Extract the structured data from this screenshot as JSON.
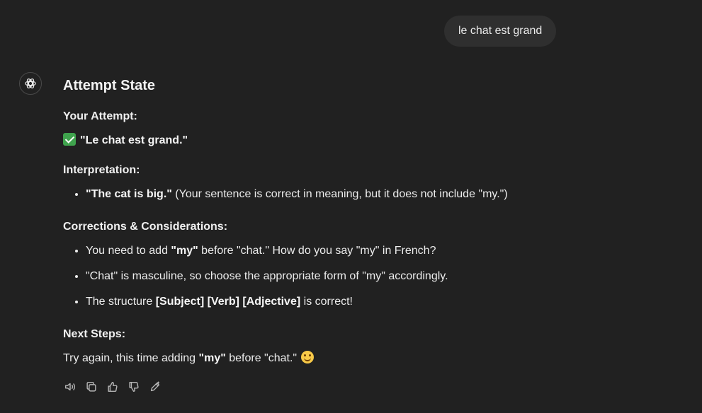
{
  "user_message": "le chat est grand",
  "assistant": {
    "title": "Attempt State",
    "attempt_label": "Your Attempt:",
    "attempt_text": "\"Le chat est grand.\"",
    "interp_label": "Interpretation:",
    "interp_bold": "\"The cat is big.\"",
    "interp_rest": " (Your sentence is correct in meaning, but it does not include \"my.\")",
    "corrections_label": "Corrections & Considerations:",
    "c1_pre": "You need to add ",
    "c1_bold": "\"my\"",
    "c1_post": " before \"chat.\" How do you say \"my\" in French?",
    "c2": "\"Chat\" is masculine, so choose the appropriate form of \"my\" accordingly.",
    "c3_pre": "The structure ",
    "c3_bold": "[Subject] [Verb] [Adjective]",
    "c3_post": " is correct!",
    "next_label": "Next Steps:",
    "next_pre": "Try again, this time adding ",
    "next_bold": "\"my\"",
    "next_post": " before \"chat.\""
  },
  "icons": [
    "read-aloud-icon",
    "copy-icon",
    "thumbs-up-icon",
    "thumbs-down-icon",
    "edit-icon"
  ]
}
